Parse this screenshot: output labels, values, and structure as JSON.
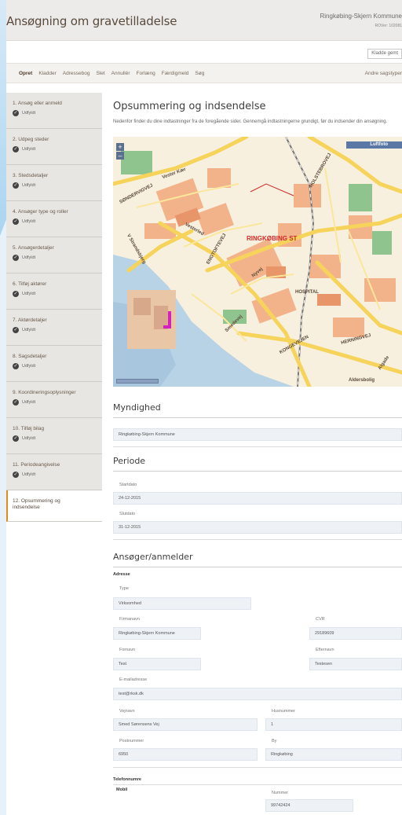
{
  "header": {
    "title": "Ansøgning om gravetilladelse",
    "municipality": "Ringkøbing-Skjern Kommune",
    "rover": "ROVer: 102081"
  },
  "draft_button": "Kladde gemt",
  "nav": {
    "items": [
      "Opret",
      "Kladder",
      "Adressebog",
      "Slet",
      "Annullér",
      "Forlæng",
      "Færdigmeld",
      "Søg"
    ],
    "right": "Andre sagstyper"
  },
  "steps": [
    {
      "label": "1. Ansøg eller anmeld",
      "status": "Udfyldt"
    },
    {
      "label": "2. Udpeg steder",
      "status": "Udfyldt"
    },
    {
      "label": "3. Stedsdetaljer",
      "status": "Udfyldt"
    },
    {
      "label": "4. Ansøger type og roller",
      "status": "Udfyldt"
    },
    {
      "label": "5. Ansøgerdetaljer",
      "status": "Udfyldt"
    },
    {
      "label": "6. Tilføj aktører",
      "status": "Udfyldt"
    },
    {
      "label": "7. Aktørdetaljer",
      "status": "Udfyldt"
    },
    {
      "label": "8. Sagsdetaljer",
      "status": "Udfyldt"
    },
    {
      "label": "9. Koordineringsoplysninger",
      "status": "Udfyldt"
    },
    {
      "label": "10. Tilføj bilag",
      "status": "Udfyldt"
    },
    {
      "label": "11. Periodeangivelse",
      "status": "Udfyldt"
    },
    {
      "label": "12. Opsummering og indsendelse",
      "status": ""
    }
  ],
  "main": {
    "title": "Opsummering og indsendelse",
    "intro": "Nedenfor finder du dine indtastninger fra de foregående sider. Gennemgå indtastningerne grundigt, før du indsender din ansøgning."
  },
  "map": {
    "luftfoto": "Luftfoto",
    "zoom_in": "+",
    "zoom_out": "–",
    "labels": {
      "vester_kaer": "Vester Kær",
      "sondervig": "SØNDERVIGVEJ",
      "vesterled": "Vesterled",
      "strandbjerg": "V Strandsbjerg",
      "engtoftevej": "ENGTOFTEVEJ",
      "ringkobing": "RINGKØBING ST",
      "hospital": "HOSPITAL",
      "nyvej": "Nyvej",
      "smedevej": "Smedevej",
      "kongevejen": "KONGEVEJEN",
      "herningvej": "HERNINGVEJ",
      "holstebrovej": "HOLSTEBROVEJ",
      "algade": "Algade",
      "aldersbolig": "Aldersbolig"
    }
  },
  "myndighed": {
    "heading": "Myndighed",
    "value": "Ringkøbing-Skjern Kommune"
  },
  "periode": {
    "heading": "Periode",
    "start_label": "Startdato",
    "start_value": "24-12-2015",
    "end_label": "Slutdato",
    "end_value": "31-12-2015"
  },
  "ansoger": {
    "heading": "Ansøger/anmelder",
    "adresse": "Adresse",
    "type_label": "Type",
    "type_value": "Virksomhed",
    "firmanavn_label": "Firmanavn",
    "firmanavn_value": "Ringkøbing-Skjern Kommune",
    "cvr_label": "CVR",
    "cvr_value": "29189609",
    "fornavn_label": "Fornavn",
    "fornavn_value": "Test",
    "efternavn_label": "Efternavn",
    "efternavn_value": "Testesen",
    "email_label": "E-mailadresse",
    "email_value": "test@rksk.dk",
    "vejnavn_label": "Vejnavn",
    "vejnavn_value": "Smed Sørensens Vej",
    "husnummer_label": "Husnummer",
    "husnummer_value": "1",
    "postnummer_label": "Postnummer",
    "postnummer_value": "6950",
    "by_label": "By",
    "by_value": "Ringkøbing",
    "telefon_heading": "Telefonnumre",
    "mobil_label": "Mobil",
    "nummer_label": "Nummer",
    "nummer_value": "99742424"
  }
}
